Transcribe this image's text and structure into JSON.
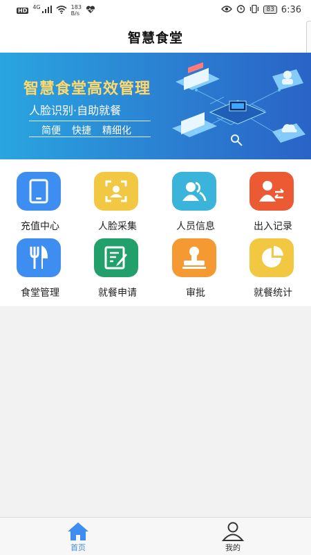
{
  "statusbar": {
    "hd": "HD",
    "network": "4G",
    "speed_value": "183",
    "speed_unit": "B/s",
    "battery": "83",
    "time": "6:36"
  },
  "header": {
    "title": "智慧食堂"
  },
  "banner": {
    "title": "智慧食堂高效管理",
    "subtitle": "人脸识别·自助就餐",
    "tags": [
      "简便",
      "快捷",
      "精细化"
    ]
  },
  "menu": [
    {
      "label": "充值中心",
      "icon": "tablet-icon",
      "color": "#3e8ef2"
    },
    {
      "label": "人脸采集",
      "icon": "face-scan-icon",
      "color": "#f2c843"
    },
    {
      "label": "人员信息",
      "icon": "users-icon",
      "color": "#3ab4da"
    },
    {
      "label": "出入记录",
      "icon": "in-out-record-icon",
      "color": "#ec5a33"
    },
    {
      "label": "食堂管理",
      "icon": "fork-knife-icon",
      "color": "#3e8ef2"
    },
    {
      "label": "就餐申请",
      "icon": "edit-form-icon",
      "color": "#22a06b"
    },
    {
      "label": "审批",
      "icon": "stamp-icon",
      "color": "#f59a33"
    },
    {
      "label": "就餐统计",
      "icon": "pie-chart-icon",
      "color": "#f2c843"
    }
  ],
  "tabbar": {
    "home_label": "首页",
    "mine_label": "我的",
    "active_color": "#3e8ef2",
    "inactive_color": "#333333"
  }
}
